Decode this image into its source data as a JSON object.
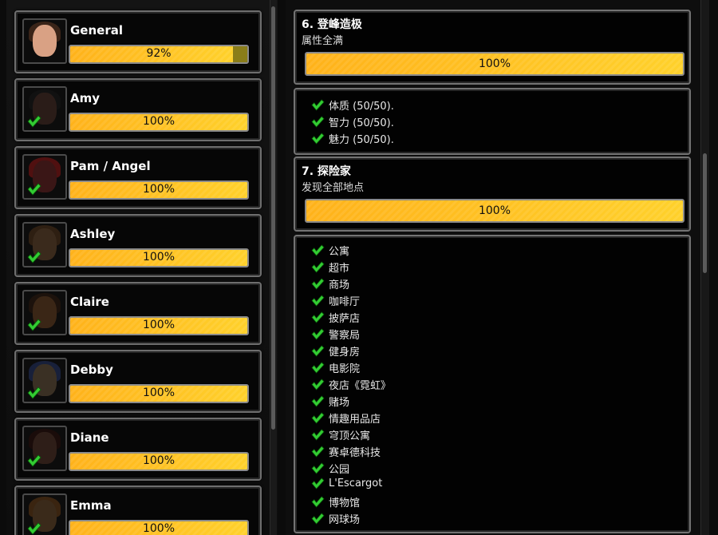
{
  "characters": [
    {
      "name": "General",
      "progress": "92%",
      "fill": 0.92,
      "completed": false,
      "face": "#d9a184",
      "hair": "#3a2418"
    },
    {
      "name": "Amy",
      "progress": "100%",
      "fill": 1.0,
      "completed": true,
      "face": "#2a1c18",
      "hair": "#111111"
    },
    {
      "name": "Pam / Angel",
      "progress": "100%",
      "fill": 1.0,
      "completed": true,
      "face": "#3a1616",
      "hair": "#501010"
    },
    {
      "name": "Ashley",
      "progress": "100%",
      "fill": 1.0,
      "completed": true,
      "face": "#3a2a1c",
      "hair": "#2e1f12"
    },
    {
      "name": "Claire",
      "progress": "100%",
      "fill": 1.0,
      "completed": true,
      "face": "#3a2616",
      "hair": "#1c120c"
    },
    {
      "name": "Debby",
      "progress": "100%",
      "fill": 1.0,
      "completed": true,
      "face": "#3a3024",
      "hair": "#18203a"
    },
    {
      "name": "Diane",
      "progress": "100%",
      "fill": 1.0,
      "completed": true,
      "face": "#2e1e18",
      "hair": "#1a0c0a"
    },
    {
      "name": "Emma",
      "progress": "100%",
      "fill": 1.0,
      "completed": true,
      "face": "#3a2a1a",
      "hair": "#3a2410"
    }
  ],
  "achievements": [
    {
      "title": "6. 登峰造极",
      "desc": "属性全满",
      "progress": "100%",
      "fill": 1.0,
      "items": [
        "体质 (50/50).",
        "智力 (50/50).",
        "魅力 (50/50)."
      ]
    },
    {
      "title": "7. 探险家",
      "desc": "发现全部地点",
      "progress": "100%",
      "fill": 1.0,
      "items": [
        "公寓",
        "超市",
        "商场",
        "咖啡厅",
        "披萨店",
        "警察局",
        "健身房",
        "电影院",
        "夜店《霓虹》",
        "赌场",
        "情趣用品店",
        "穹顶公寓",
        "赛卓德科技",
        "公园",
        "L'Escargot",
        "博物馆",
        "网球场"
      ]
    }
  ],
  "colors": {
    "bar_start": "#ffb21a",
    "bar_end": "#ffd12b",
    "check": "#33cc33"
  },
  "icons": {
    "check": "check-icon",
    "avatar": "character-portrait"
  }
}
